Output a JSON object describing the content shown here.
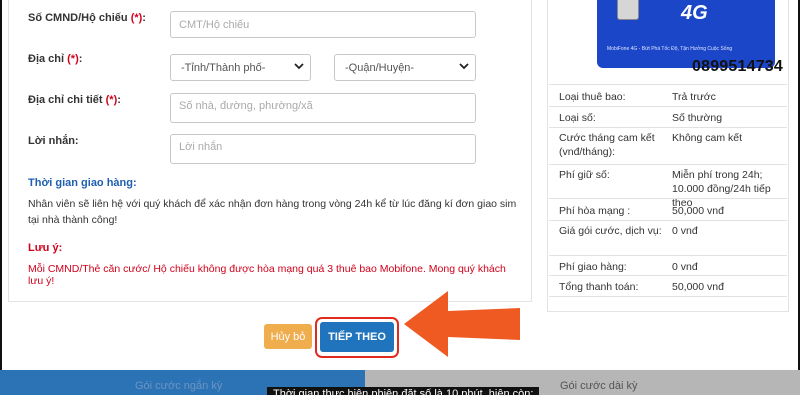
{
  "form": {
    "id_label": "Số CMND/Hộ chiếu",
    "id_placeholder": "CMT/Hộ chiếu",
    "address_label": "Địa chỉ",
    "province_select": "-Tỉnh/Thành phố-",
    "district_select": "-Quận/Huyện-",
    "address_detail_label": "Địa chỉ chi tiết",
    "address_detail_placeholder": "Số nhà, đường, phường/xã",
    "message_label": "Lời nhắn:",
    "message_placeholder": "Lời nhắn",
    "required_mark": "(*)",
    "colon": ":"
  },
  "delivery": {
    "title": "Thời gian giao hàng:",
    "text": "Nhân viên sẽ liên hệ với quý khách để xác nhận đơn hàng trong vòng 24h kể từ lúc đăng kí đơn giao sim tại nhà thành công!"
  },
  "note": {
    "title": "Lưu ý:",
    "text": "Mỗi CMND/Thẻ căn cước/ Hộ chiếu không được hòa mạng quá 3 thuê bao Mobifone. Mong quý khách lưu ý!"
  },
  "sim": {
    "label_4g": "4G",
    "tagline": "MobiFone 4G - Bứt Phá Tốc Độ, Tận Hưởng Cuộc Sống",
    "phone": "0899514734"
  },
  "info": [
    {
      "k": "Loại thuê bao:",
      "v": "Trả trước"
    },
    {
      "k": "Loại số:",
      "v": "Số thường"
    },
    {
      "k": "Cước tháng cam kết (vnđ/tháng):",
      "v": "Không cam kết"
    },
    {
      "k": "Phí giữ số:",
      "v": "Miễn phí trong 24h; 10.000 đồng/24h tiếp theo"
    },
    {
      "k": "Phí hòa mạng :",
      "v": "50,000 vnđ"
    },
    {
      "k": "Giá gói cước, dịch vụ:",
      "v": "0 vnđ"
    },
    {
      "k": "Phí giao hàng:",
      "v": "0 vnđ"
    },
    {
      "k": "Tổng thanh toán:",
      "v": "50,000 vnđ"
    }
  ],
  "buttons": {
    "cancel": "Hủy bỏ",
    "next": "TIẾP THEO"
  },
  "bottom": {
    "short_tab": "Gói cước ngắn kỳ",
    "long_tab": "Gói cước dài kỳ",
    "session_note": "Thời gian thực hiện phiên đặt số là 10 phút, hiện còn:"
  },
  "colors": {
    "required": "#d0021b",
    "primary": "#1f74bd",
    "warning": "#f0ad4e",
    "highlight": "#e12b1f",
    "sim_blue": "#1c46c8"
  }
}
